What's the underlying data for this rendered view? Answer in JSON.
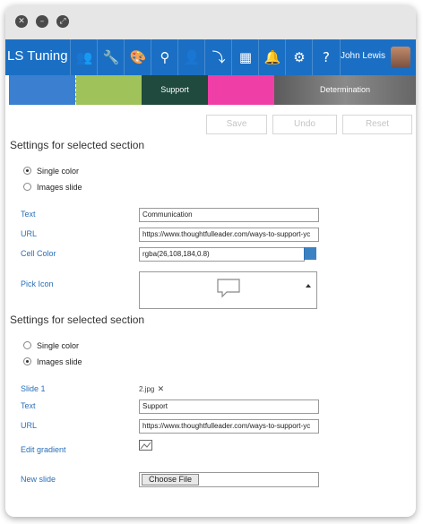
{
  "app": {
    "title": "LS Tuning",
    "user_name": "John Lewis"
  },
  "nav_icons": [
    "users-icon",
    "wrench-icon",
    "palette-icon",
    "search-icon",
    "user-icon",
    "arrow-down-icon",
    "grid-icon",
    "bell-icon",
    "gear-icon",
    "help-icon"
  ],
  "preview_strip": {
    "cells": [
      "",
      "",
      "Support",
      "",
      "Determination"
    ]
  },
  "toolbar": {
    "save_label": "Save",
    "undo_label": "Undo",
    "reset_label": "Reset"
  },
  "section1": {
    "title": "Settings for selected section",
    "radio_single": "Single color",
    "radio_images": "Images slide",
    "selected": "single",
    "text_label": "Text",
    "text_value": "Communication",
    "url_label": "URL",
    "url_value": "https://www.thoughtfulleader.com/ways-to-support-yc",
    "cell_color_label": "Cell Color",
    "cell_color_value": "rgba(26,108,184,0.8)",
    "pick_icon_label": "Pick Icon"
  },
  "section2": {
    "title": "Settings for selected section",
    "radio_single": "Single color",
    "radio_images": "Images slide",
    "selected": "images",
    "slide_label": "Slide 1",
    "slide_file": "2.jpg",
    "text_label": "Text",
    "text_value": "Support",
    "url_label": "URL",
    "url_value": "https://www.thoughtfulleader.com/ways-to-support-yc",
    "edit_gradient_label": "Edit gradient",
    "new_slide_label": "New slide",
    "choose_file_label": "Choose File"
  }
}
